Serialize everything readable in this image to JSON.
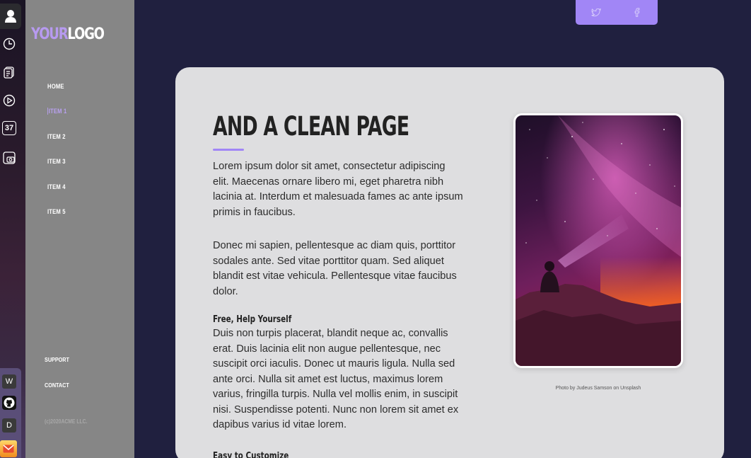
{
  "dock": {
    "icons": [
      "user-icon",
      "clock-icon",
      "notes-icon",
      "play-icon",
      "calendar-icon",
      "camera-icon"
    ],
    "calendar_day": "37",
    "apps": [
      {
        "name": "w-app-icon",
        "label": "W",
        "color": "#3a3a3a"
      },
      {
        "name": "github-icon",
        "label": "",
        "color": "#111111"
      },
      {
        "name": "d-app-icon",
        "label": "D",
        "color": "#3a3a3a"
      },
      {
        "name": "mail-app-icon",
        "label": "",
        "color": "#f5a623"
      }
    ]
  },
  "sidebar": {
    "logo_part1": "YOUR",
    "logo_part2": "LOGO",
    "items": [
      "HOME",
      "ITEM 1",
      "ITEM 2",
      "ITEM 3",
      "ITEM 4",
      "ITEM 5"
    ],
    "active_index": 1,
    "footer_items": [
      "SUPPORT",
      "CONTACT"
    ],
    "copyright": "(c)2020ACME LLC."
  },
  "social": {
    "icons": [
      "twitter-icon",
      "facebook-icon"
    ]
  },
  "content": {
    "title": "AND A CLEAN PAGE",
    "paragraph1": "Lorem ipsum dolor sit amet, consectetur adipiscing elit. Maecenas ornare libero mi, eget pharetra nibh lacinia at. Interdum et malesuada fames ac ante ipsum primis in faucibus.",
    "paragraph2": "Donec mi sapien, pellentesque ac diam quis, porttitor sodales ante. Sed vitae porttitor quam. Sed aliquet blandit est vitae vehicula. Pellentesque vitae faucibus dolor.",
    "subheading1": "Free, Help Yourself",
    "paragraph3": "Duis non turpis placerat, blandit neque ac, convallis erat. Duis lacinia elit non augue pellentesque, nec suscipit orci iaculis. Donec ut mauris ligula. Nulla sed ante orci. Nulla sit amet est luctus, maximus lorem varius, fringilla turpis. Nulla vel mollis enim, in suscipit nisi. Suspendisse potenti. Nunc non lorem sit amet ex dapibus varius id vitae lorem.",
    "subheading2": "Easy to Customize",
    "photo_caption": "Photo by Judeus Samson on Unsplash"
  },
  "colors": {
    "accent": "#a186f6",
    "background": "#20203f",
    "sidebar": "#868686",
    "card": "#dedee0"
  }
}
